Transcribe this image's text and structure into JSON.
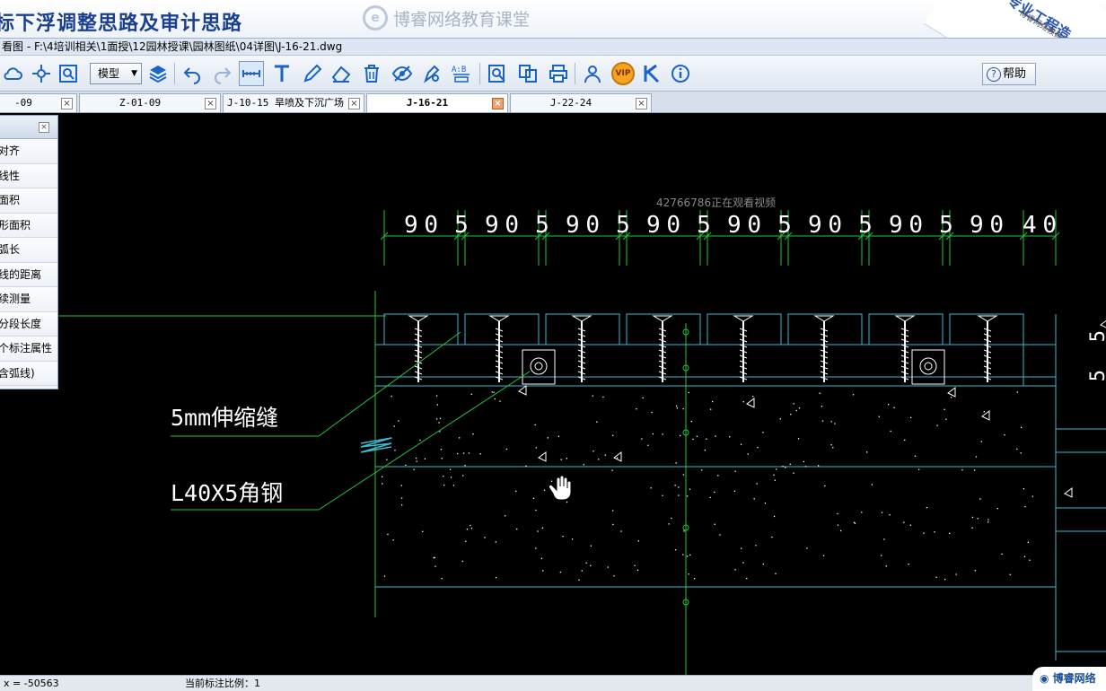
{
  "banner": {
    "title": "标下浮调整思路及审计思路",
    "watermark": "博睿网络教育课堂",
    "corner_brand": "专业工程造",
    "corner_sub": "博睿网络教育课堂QQ:"
  },
  "path_bar": "看图 - F:\\4培训相关\\1面授\\12园林授课\\园林图纸\\04详图\\J-16-21.dwg",
  "toolbar": {
    "model_select": "模型",
    "help_label": "帮助",
    "vip_label": "VIP"
  },
  "tabs": [
    {
      "label": "-09"
    },
    {
      "label": "Z-01-09"
    },
    {
      "label": "J-10-15 旱喷及下沉广场"
    },
    {
      "label": "J-16-21"
    },
    {
      "label": "J-22-24"
    }
  ],
  "measure_panel": {
    "items": [
      "对齐",
      "线性",
      "面积",
      "形面积",
      "弧长",
      "线的距离",
      "续测量",
      "分段长度",
      "个标注属性",
      "含弧线)"
    ]
  },
  "drawing": {
    "viewer_overlay": "42766786正在观看视频",
    "dimensions": [
      "90",
      "5",
      "90",
      "5",
      "90",
      "5",
      "90",
      "5",
      "90",
      "5",
      "90",
      "5",
      "90",
      "5",
      "90",
      "40"
    ],
    "label_joint": "5mm伸缩缝",
    "label_angle": "L40X5角钢",
    "right_dims": [
      "5",
      "5"
    ]
  },
  "status": {
    "coords": "x = -50563",
    "scale": "当前标注比例：1",
    "logo": "博睿网络"
  },
  "colors": {
    "green": "#22c43a",
    "cyan": "#3fb7cf",
    "white": "#ffffff",
    "toolbar_icon": "#1a63c7"
  }
}
